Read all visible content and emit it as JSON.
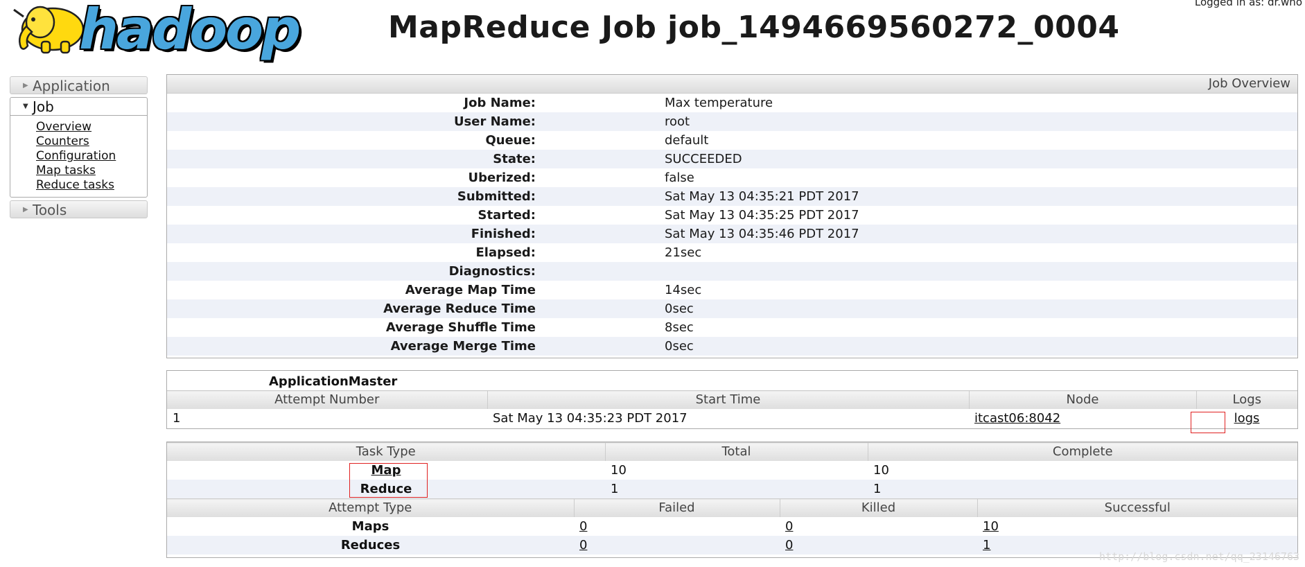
{
  "header": {
    "logged_in": "Logged in as: dr.who",
    "logo_text": "hadoop",
    "title": "MapReduce Job job_1494669560272_0004"
  },
  "sidebar": {
    "application": "Application",
    "job": "Job",
    "job_links": [
      "Overview",
      "Counters",
      "Configuration",
      "Map tasks",
      "Reduce tasks"
    ],
    "tools": "Tools"
  },
  "overview": {
    "heading": "Job Overview",
    "rows": [
      {
        "key": "Job Name:",
        "value": "Max temperature"
      },
      {
        "key": "User Name:",
        "value": "root"
      },
      {
        "key": "Queue:",
        "value": "default"
      },
      {
        "key": "State:",
        "value": "SUCCEEDED"
      },
      {
        "key": "Uberized:",
        "value": "false"
      },
      {
        "key": "Submitted:",
        "value": "Sat May 13 04:35:21 PDT 2017"
      },
      {
        "key": "Started:",
        "value": "Sat May 13 04:35:25 PDT 2017"
      },
      {
        "key": "Finished:",
        "value": "Sat May 13 04:35:46 PDT 2017"
      },
      {
        "key": "Elapsed:",
        "value": "21sec"
      },
      {
        "key": "Diagnostics:",
        "value": ""
      },
      {
        "key": "Average Map Time",
        "value": "14sec"
      },
      {
        "key": "Average Reduce Time",
        "value": "0sec"
      },
      {
        "key": "Average Shuffle Time",
        "value": "8sec"
      },
      {
        "key": "Average Merge Time",
        "value": "0sec"
      }
    ]
  },
  "app_master": {
    "caption": "ApplicationMaster",
    "headers": [
      "Attempt Number",
      "Start Time",
      "Node",
      "Logs"
    ],
    "row": {
      "attempt": "1",
      "start": "Sat May 13 04:35:23 PDT 2017",
      "node": "itcast06:8042",
      "logs": "logs"
    }
  },
  "tasks": {
    "headers": [
      "Task Type",
      "Total",
      "Complete"
    ],
    "rows": [
      {
        "type": "Map",
        "total": "10",
        "complete": "10"
      },
      {
        "type": "Reduce",
        "total": "1",
        "complete": "1"
      }
    ]
  },
  "attempts": {
    "headers": [
      "Attempt Type",
      "Failed",
      "Killed",
      "Successful"
    ],
    "rows": [
      {
        "type": "Maps",
        "failed": "0",
        "killed": "0",
        "successful": "10"
      },
      {
        "type": "Reduces",
        "failed": "0",
        "killed": "0",
        "successful": "1"
      }
    ]
  },
  "watermark": "http://blog.csdn.net/qq_23146763"
}
